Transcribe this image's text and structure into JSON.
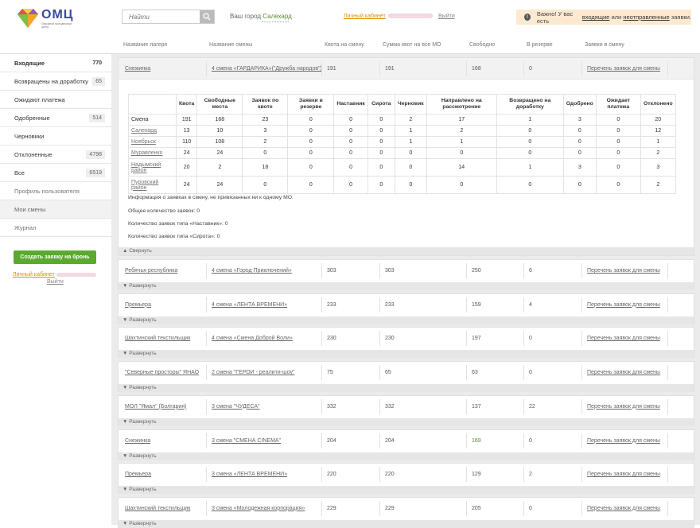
{
  "header": {
    "logo_text": "ОМЦ",
    "logo_sub": "Окружной молодежный центр",
    "search_placeholder": "Найти",
    "city_label": "Ваш город",
    "city_name": "Салехард",
    "cabinet_link": "Личный кабинет",
    "exit": "Выйти",
    "notice_pre": "Важно! У вас есть",
    "notice_link1": "входящие",
    "notice_mid": "или",
    "notice_link2": "неотправленные",
    "notice_post": "заявки."
  },
  "columns": [
    "Название лагеря",
    "Название смены",
    "Квота на смену",
    "Сумма квот на все МО",
    "Свободно",
    "В резерве",
    "Заявки в смену"
  ],
  "sidebar": {
    "items": [
      {
        "label": "Входящие",
        "count": "770"
      },
      {
        "label": "Возвращены на доработку",
        "count": "65"
      },
      {
        "label": "Ожидают платежа",
        "count": ""
      },
      {
        "label": "Одобренные",
        "count": "514"
      },
      {
        "label": "Черновики",
        "count": ""
      },
      {
        "label": "Отклоненные",
        "count": "4798"
      },
      {
        "label": "Все",
        "count": "6519"
      },
      {
        "label": "Профиль пользователя",
        "count": ""
      },
      {
        "label": "Мои смены",
        "count": ""
      },
      {
        "label": "Журнал",
        "count": ""
      }
    ],
    "create_button": "Создать заявку на бронь",
    "cabinet_link": "Личный кабинет",
    "exit": "Выйти"
  },
  "expanded": {
    "camp": "Снежинка",
    "shift": "4 смена «ГАРДАРИКА»(\"Дружба народов\")",
    "quota": "191",
    "sum": "191",
    "free": "168",
    "reserve": "0",
    "link": "Перечень заявок для смены",
    "toggle": "▲ Свернуть",
    "table": {
      "headers": [
        "",
        "Квота",
        "Свободные места",
        "Заявок по квоте",
        "Заявки в резерве",
        "Наставник",
        "Сирота",
        "Черновик",
        "Направлено на рассмотрение",
        "Возвращено на доработку",
        "Одобрено",
        "Ожидает платежа",
        "Отклонено"
      ],
      "rows": [
        [
          "Смена",
          "191",
          "168",
          "23",
          "0",
          "0",
          "0",
          "2",
          "17",
          "1",
          "3",
          "0",
          "20"
        ],
        [
          "Салехард",
          "13",
          "10",
          "3",
          "0",
          "0",
          "0",
          "1",
          "2",
          "0",
          "0",
          "0",
          "12"
        ],
        [
          "Ноябрьск",
          "110",
          "108",
          "2",
          "0",
          "0",
          "0",
          "1",
          "1",
          "0",
          "0",
          "0",
          "1"
        ],
        [
          "Муравленко",
          "24",
          "24",
          "0",
          "0",
          "0",
          "0",
          "0",
          "0",
          "0",
          "0",
          "0",
          "2"
        ],
        [
          "Надымский район",
          "20",
          "2",
          "18",
          "0",
          "0",
          "0",
          "0",
          "14",
          "1",
          "3",
          "0",
          "3"
        ],
        [
          "Пуровский район",
          "24",
          "24",
          "0",
          "0",
          "0",
          "0",
          "0",
          "0",
          "0",
          "0",
          "0",
          "2"
        ]
      ]
    },
    "info": [
      "Информация о заявках в смену, не привязанных ни к одному МО:",
      "Общее количество заявок: 0",
      "Количество заявок типа «Наставник»: 0",
      "Количество заявок типа «Сирота»: 0"
    ]
  },
  "shifts": [
    {
      "camp": "Ребячья республика",
      "shift": "4 смена «Город Приключений»",
      "quota": "303",
      "sum": "303",
      "free": "250",
      "reserve": "6",
      "link": "Перечень заявок для смены",
      "toggle": "▼ Развернуть"
    },
    {
      "camp": "Премьера",
      "shift": "4 смена «ЛЕНТА ВРЕМЕНИ»",
      "quota": "233",
      "sum": "233",
      "free": "159",
      "reserve": "4",
      "link": "Перечень заявок для смены",
      "toggle": "▼ Развернуть"
    },
    {
      "camp": "Шахтинский текстильщик",
      "shift": "4 смена «Смена Доброй Воли»",
      "quota": "230",
      "sum": "230",
      "free": "197",
      "reserve": "0",
      "link": "Перечень заявок для смены",
      "toggle": "▼ Развернуть"
    },
    {
      "camp": "\"Северные просторы\" ЯНАО",
      "shift": "2 смена \"ГЕРОИ - реалити-шоу\"",
      "quota": "75",
      "sum": "65",
      "free": "63",
      "reserve": "0",
      "link": "Перечень заявок для смены",
      "toggle": "▼ Развернуть"
    },
    {
      "camp": "МОЛ \"Ямал\" (Болгария)",
      "shift": "3 смена \"ЧУДЕСА\"",
      "quota": "332",
      "sum": "332",
      "free": "137",
      "reserve": "22",
      "link": "Перечень заявок для смены",
      "toggle": "▼ Развернуть"
    },
    {
      "camp": "Снежинка",
      "shift": "3 смена \"СМЕНА CINEMA\"",
      "quota": "204",
      "sum": "204",
      "free": "169",
      "reserve": "0",
      "link": "Перечень заявок для смены",
      "toggle": "▼ Развернуть"
    },
    {
      "camp": "Премьера",
      "shift": "3 смена «ЛЕНТА ВРЕМЕНИ»",
      "quota": "220",
      "sum": "220",
      "free": "129",
      "reserve": "2",
      "link": "Перечень заявок для смены",
      "toggle": "▼ Развернуть"
    },
    {
      "camp": "Шахтинский текстильщик",
      "shift": "3 смена «Молодежная корпорация»",
      "quota": "229",
      "sum": "229",
      "free": "205",
      "reserve": "0",
      "link": "Перечень заявок для смены",
      "toggle": "▼ Развернуть"
    }
  ],
  "colors": {
    "accent_green": "#5aaa30",
    "link_orange": "#e08a10",
    "notice_bg": "#fde9d0"
  }
}
